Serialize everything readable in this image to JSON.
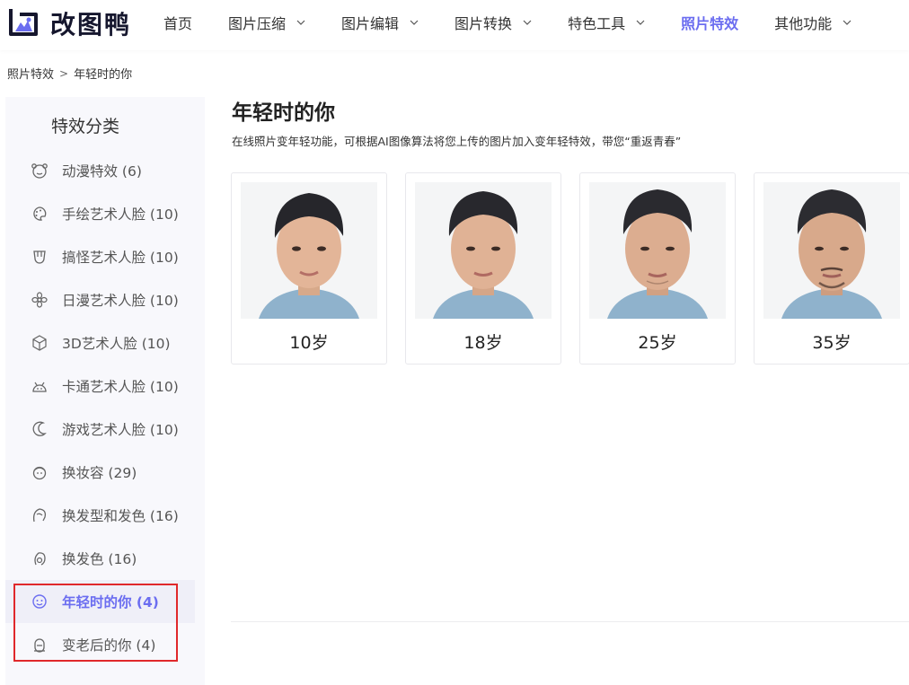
{
  "brand": {
    "name": "改图鸭",
    "accent": "#6b6df0"
  },
  "nav": {
    "items": [
      {
        "label": "首页",
        "dropdown": false,
        "active": false
      },
      {
        "label": "图片压缩",
        "dropdown": true,
        "active": false
      },
      {
        "label": "图片编辑",
        "dropdown": true,
        "active": false
      },
      {
        "label": "图片转换",
        "dropdown": true,
        "active": false
      },
      {
        "label": "特色工具",
        "dropdown": true,
        "active": false
      },
      {
        "label": "照片特效",
        "dropdown": false,
        "active": true
      },
      {
        "label": "其他功能",
        "dropdown": true,
        "active": false
      }
    ]
  },
  "breadcrumb": {
    "parent": "照片特效",
    "separator": ">",
    "current": "年轻时的你"
  },
  "sidebar": {
    "title": "特效分类",
    "items": [
      {
        "label": "动漫特效 (6)",
        "icon": "bear-face-icon"
      },
      {
        "label": "手绘艺术人脸 (10)",
        "icon": "palette-icon"
      },
      {
        "label": "搞怪艺术人脸 (10)",
        "icon": "cup-icon"
      },
      {
        "label": "日漫艺术人脸 (10)",
        "icon": "flower-icon"
      },
      {
        "label": "3D艺术人脸 (10)",
        "icon": "cube-icon"
      },
      {
        "label": "卡通艺术人脸 (10)",
        "icon": "robot-icon"
      },
      {
        "label": "游戏艺术人脸 (10)",
        "icon": "moon-icon"
      },
      {
        "label": "换妆容 (29)",
        "icon": "makeup-face-icon"
      },
      {
        "label": "换发型和发色 (16)",
        "icon": "hair-icon"
      },
      {
        "label": "换发色 (16)",
        "icon": "hair-color-icon"
      },
      {
        "label": "年轻时的你 (4)",
        "icon": "smile-face-icon",
        "active": true
      },
      {
        "label": "变老后的你 (4)",
        "icon": "old-face-icon"
      }
    ]
  },
  "main": {
    "title": "年轻时的你",
    "description": "在线照片变年轻功能，可根据AI图像算法将您上传的图片加入变年轻特效，带您“重返青春”",
    "cards": [
      {
        "label": "10岁"
      },
      {
        "label": "18岁"
      },
      {
        "label": "25岁"
      },
      {
        "label": "35岁"
      }
    ]
  },
  "colors": {
    "highlight_box": "#e0282b",
    "active_item_bg": "#efeff8",
    "sidebar_bg": "#f8f8fc"
  }
}
